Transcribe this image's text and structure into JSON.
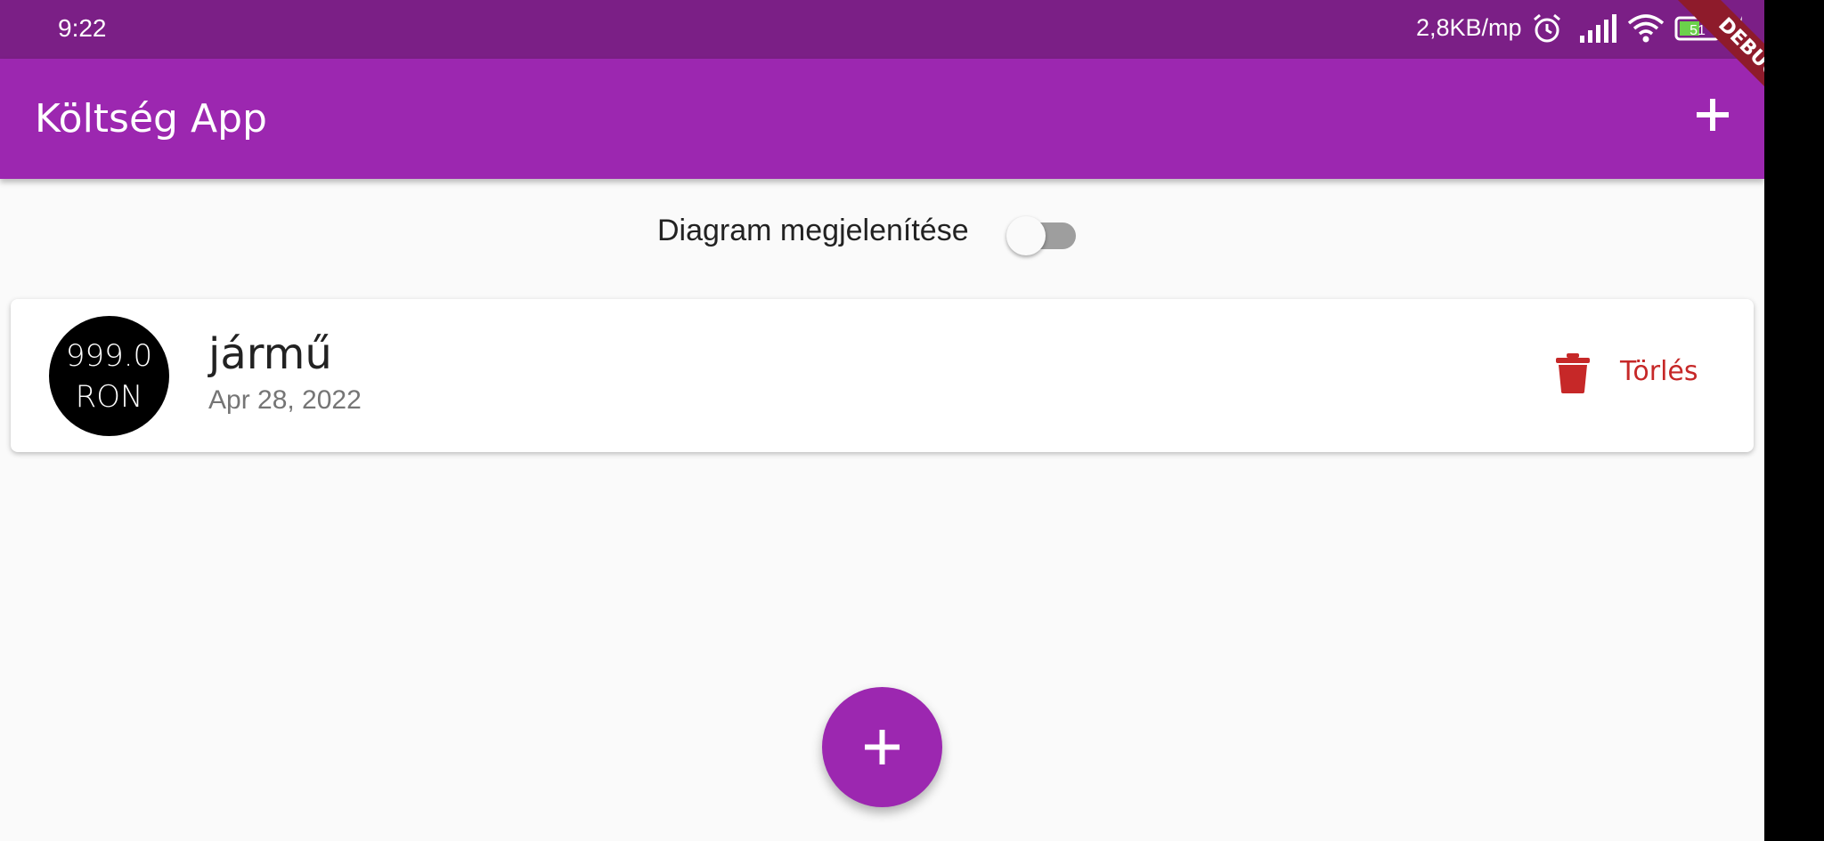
{
  "status_bar": {
    "time": "9:22",
    "network_speed": "2,8KB/mp",
    "battery_level": "51",
    "icons": [
      "alarm-icon",
      "signal-icon",
      "wifi-icon",
      "battery-icon",
      "charging-icon"
    ]
  },
  "app_bar": {
    "title": "Költség App",
    "add_icon": "add-icon",
    "debug_banner": "DEBUG"
  },
  "toggle": {
    "label": "Diagram megjelenítése",
    "enabled": false
  },
  "transactions": [
    {
      "amount": "999.0",
      "currency": "RON",
      "title": "jármű",
      "date": "Apr 28, 2022",
      "delete_label": "Törlés",
      "delete_icon": "trash-icon"
    }
  ],
  "fab": {
    "icon": "add-icon"
  },
  "colors": {
    "primary": "#9c27b0",
    "status_bar": "#7b1f86",
    "delete": "#c62828",
    "avatar": "#000000",
    "switch_track": "#9e9e9e"
  }
}
